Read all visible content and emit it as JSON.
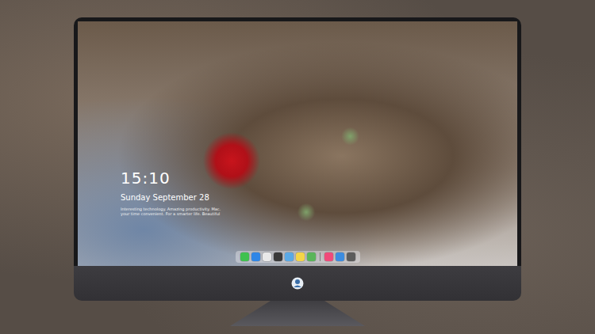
{
  "screen": {
    "time": "15:10",
    "date": "Sunday September 28",
    "caption": [
      "Interesting technology. Amazing productivity. Mac.",
      "your time convenient. For a smarter life. Beautiful"
    ]
  },
  "dock": {
    "apps": [
      {
        "color": "#3fc14f"
      },
      {
        "color": "#2f86e6"
      },
      {
        "color": "#e9e9e9"
      },
      {
        "color": "#3a3a3a"
      },
      {
        "color": "#5aa9e6"
      },
      {
        "color": "#f5d547"
      },
      {
        "color": "#5ab55a"
      }
    ],
    "recent": [
      {
        "color": "#f04a7a"
      },
      {
        "color": "#3c8ce0"
      },
      {
        "color": "#5c5c5c"
      }
    ]
  }
}
